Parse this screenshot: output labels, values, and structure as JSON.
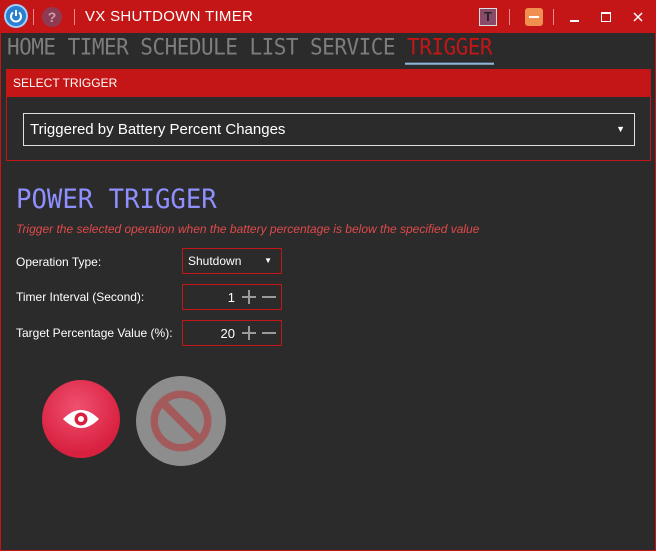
{
  "window": {
    "title": "VX SHUTDOWN TIMER",
    "help_glyph": "?",
    "badge_letter": "T",
    "accent_color": "#c41616"
  },
  "tabs": [
    {
      "label": "HOME",
      "active": false
    },
    {
      "label": "TIMER",
      "active": false
    },
    {
      "label": "SCHEDULE",
      "active": false
    },
    {
      "label": "LIST",
      "active": false
    },
    {
      "label": "SERVICE",
      "active": false
    },
    {
      "label": "TRIGGER",
      "active": true
    }
  ],
  "select_trigger": {
    "header": "SELECT TRIGGER",
    "selected": "Triggered by Battery Percent Changes"
  },
  "power_trigger": {
    "title": "POWER TRIGGER",
    "description": "Trigger the selected operation when the battery percentage is below the specified value",
    "operation_type_label": "Operation Type:",
    "operation_type_value": "Shutdown",
    "timer_interval_label": "Timer Interval (Second):",
    "timer_interval_value": "1",
    "target_percentage_label": "Target Percentage Value (%):",
    "target_percentage_value": "20"
  },
  "actions": {
    "start_icon": "eye-icon",
    "stop_icon": "no-entry-icon"
  }
}
